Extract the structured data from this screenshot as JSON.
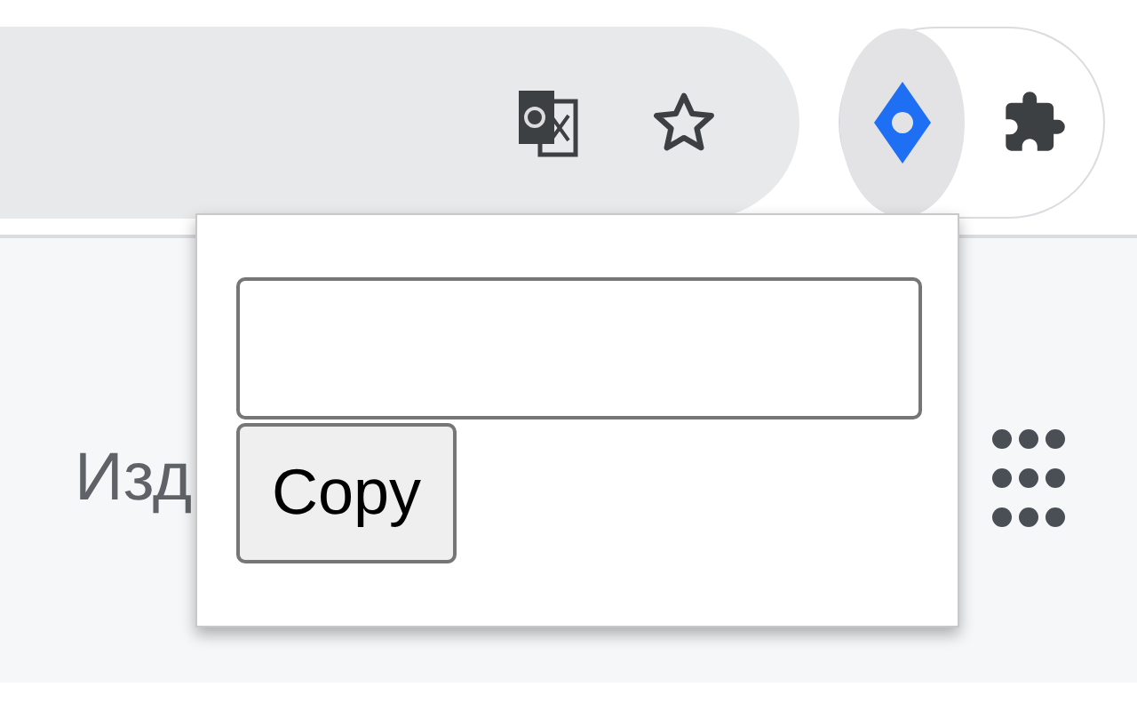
{
  "toolbar": {
    "extensions": [
      {
        "kind": "jira",
        "selected": true
      },
      {
        "kind": "puzzle",
        "selected": false
      }
    ]
  },
  "page": {
    "heading": "Изд"
  },
  "popup": {
    "button": "Copy"
  }
}
